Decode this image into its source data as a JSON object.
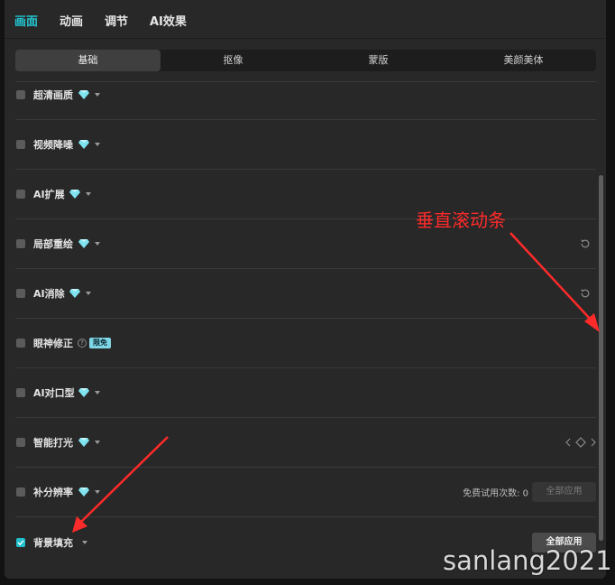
{
  "top_tabs": [
    {
      "label": "画面",
      "active": true
    },
    {
      "label": "动画",
      "active": false
    },
    {
      "label": "调节",
      "active": false
    },
    {
      "label": "AI效果",
      "active": false
    }
  ],
  "sub_tabs": [
    {
      "label": "基础",
      "active": true
    },
    {
      "label": "抠像",
      "active": false
    },
    {
      "label": "蒙版",
      "active": false
    },
    {
      "label": "美颜美体",
      "active": false
    }
  ],
  "features": [
    {
      "label": "超清画质",
      "checked": false,
      "premium": true
    },
    {
      "label": "视频降噪",
      "checked": false,
      "premium": true
    },
    {
      "label": "AI扩展",
      "checked": false,
      "premium": true
    },
    {
      "label": "局部重绘",
      "checked": false,
      "premium": true
    },
    {
      "label": "AI消除",
      "checked": false,
      "premium": true
    },
    {
      "label": "眼神修正",
      "checked": false,
      "premium": false,
      "help": "?",
      "badge": "限免"
    },
    {
      "label": "AI对口型",
      "checked": false,
      "premium": true
    },
    {
      "label": "智能打光",
      "checked": false,
      "premium": true
    },
    {
      "label": "补分辨率",
      "checked": false,
      "premium": true,
      "trial_text": "免费试用次数: 0",
      "button": "全部应用",
      "button_enabled": false
    },
    {
      "label": "背景填充",
      "checked": true,
      "premium": false,
      "button": "全部应用",
      "button_enabled": true
    }
  ],
  "icons": {
    "premium": "diamond-icon",
    "dropdown": "chevron-down-icon",
    "reset": "reset-icon",
    "keyframe": "keyframe-nav-icon",
    "help": "help-circle-icon",
    "check": "checkmark-icon"
  },
  "colors": {
    "accent": "#20c0cc",
    "panel_bg": "#282828",
    "annotation": "#ff2a2a",
    "diamond": "#7fe3f0"
  },
  "annotation": {
    "text": "垂直滚动条"
  },
  "watermark": {
    "text": "sanlang2021"
  }
}
